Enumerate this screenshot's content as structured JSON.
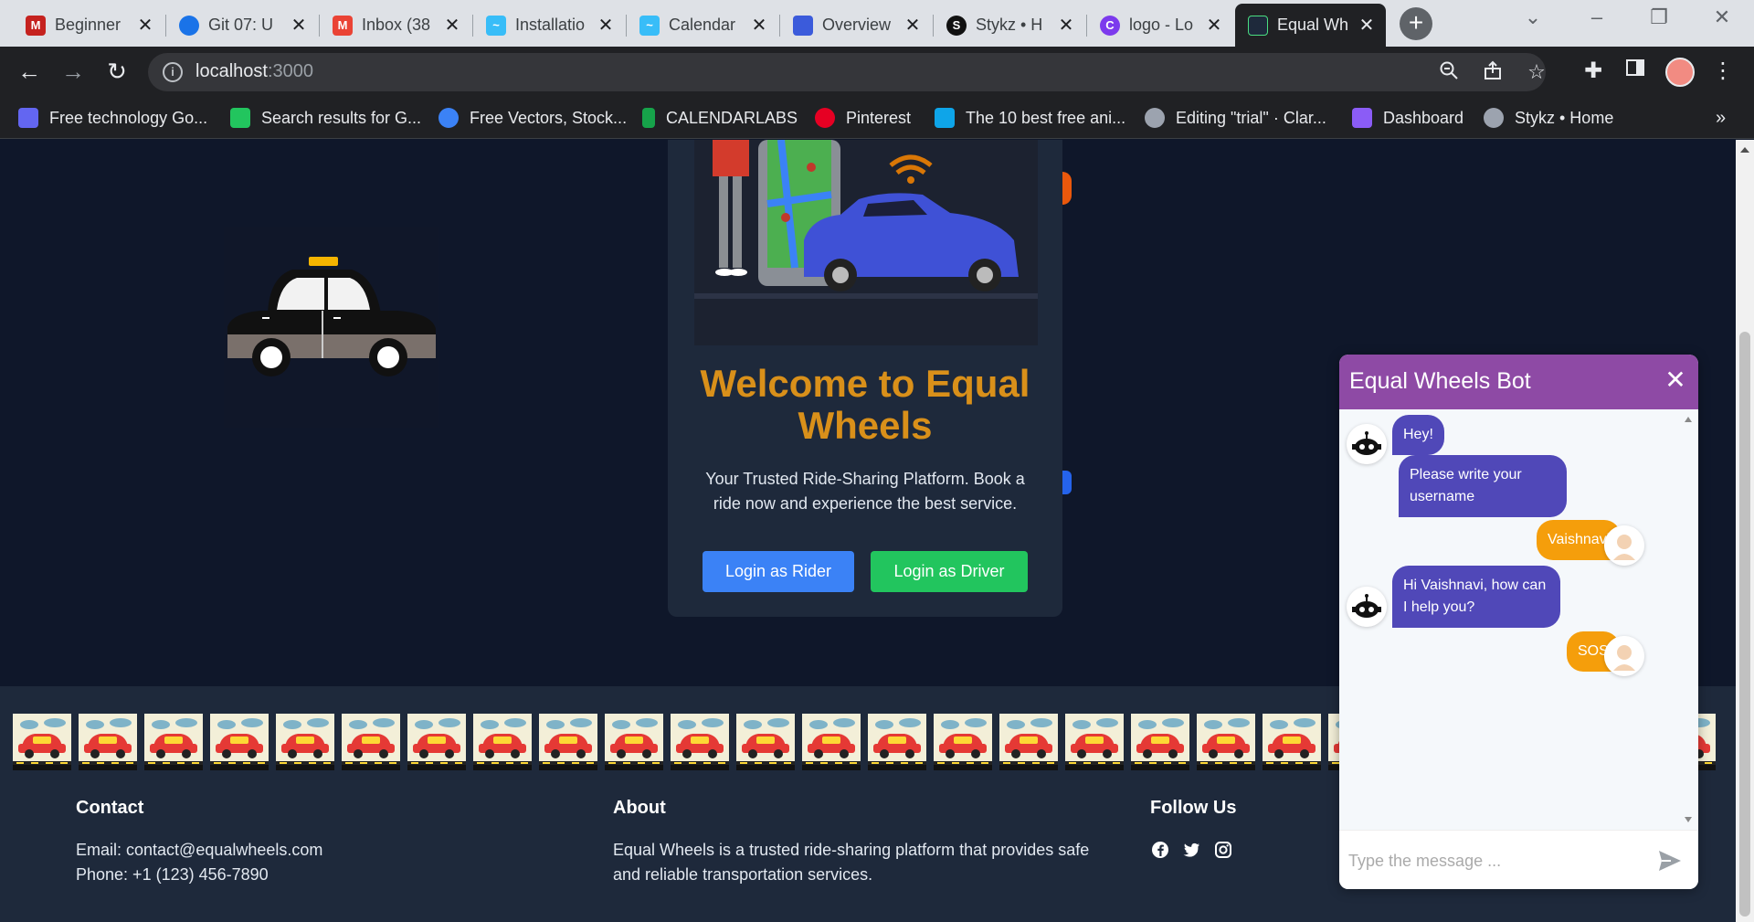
{
  "browser": {
    "tabs": [
      {
        "title": "Beginner",
        "icon": "mdn-icon",
        "color": "#c5221f"
      },
      {
        "title": "Git 07: U",
        "icon": "git-icon",
        "color": "#1a73e8"
      },
      {
        "title": "Inbox (38",
        "icon": "gmail-icon",
        "color": "#ea4335"
      },
      {
        "title": "Installatio",
        "icon": "tailwind-icon",
        "color": "#38bdf8"
      },
      {
        "title": "Calendar",
        "icon": "tailwind-icon",
        "color": "#38bdf8"
      },
      {
        "title": "Overview",
        "icon": "hexagon-icon",
        "color": "#3b5bdb"
      },
      {
        "title": "Stykz • H",
        "icon": "stykz-icon",
        "color": "#111111"
      },
      {
        "title": "logo - Lo",
        "icon": "canva-icon",
        "color": "#7c3aed"
      },
      {
        "title": "Equal Wh",
        "icon": "equal-wheels-icon",
        "color": "#1e293b"
      }
    ],
    "url_host": "localhost",
    "url_port": ":3000",
    "bookmarks": [
      {
        "label": "Free technology Go...",
        "color": "#6366f1"
      },
      {
        "label": "Search results for G...",
        "color": "#22c55e"
      },
      {
        "label": "Free Vectors, Stock...",
        "color": "#3b82f6"
      },
      {
        "label": "CALENDARLABS",
        "color": "#16a34a"
      },
      {
        "label": "Pinterest",
        "color": "#e60023"
      },
      {
        "label": "The 10 best free ani...",
        "color": "#0ea5e9"
      },
      {
        "label": "Editing \"trial\" · Clar...",
        "color": "#9ca3af"
      },
      {
        "label": "Dashboard",
        "color": "#8b5cf6"
      },
      {
        "label": "Stykz • Home",
        "color": "#9ca3af"
      }
    ],
    "more": "»"
  },
  "hero": {
    "title_line1": "Welcome to Equal",
    "title_line2": "Wheels",
    "subtitle": "Your Trusted Ride-Sharing Platform. Book a ride now and experience the best service.",
    "rider_button": "Login as Rider",
    "driver_button": "Login as Driver"
  },
  "footer": {
    "contact_title": "Contact",
    "email": "Email: contact@equalwheels.com",
    "phone": "Phone: +1 (123) 456-7890",
    "about_title": "About",
    "about_text": "Equal Wheels is a trusted ride-sharing platform that provides safe and reliable transportation services.",
    "follow_title": "Follow Us",
    "social": [
      "facebook-icon",
      "twitter-icon",
      "instagram-icon"
    ]
  },
  "chatbot": {
    "title": "Equal Wheels Bot",
    "close": "✕",
    "messages": [
      {
        "from": "bot",
        "text": "Hey!"
      },
      {
        "from": "bot",
        "text": "Please write your username"
      },
      {
        "from": "user",
        "text": "Vaishnavi"
      },
      {
        "from": "bot",
        "text": "Hi Vaishnavi, how can I help you?"
      },
      {
        "from": "user",
        "text": "SOS"
      }
    ],
    "input_placeholder": "Type the message ..."
  },
  "colors": {
    "page_bg": "#0f172a",
    "card_bg": "#1e293b",
    "accent": "#d9901a",
    "rider": "#3b82f6",
    "driver": "#22c55e",
    "chat_header": "#8e4aa5",
    "bot_bubble": "#5048b8",
    "user_bubble": "#f59e0b"
  }
}
